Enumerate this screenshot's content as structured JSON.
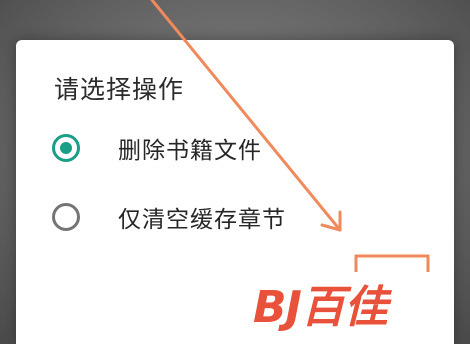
{
  "dialog": {
    "title": "请选择操作",
    "options": [
      {
        "label": "删除书籍文件",
        "selected": true
      },
      {
        "label": "仅清空缓存章节",
        "selected": false
      }
    ]
  },
  "colors": {
    "accent": "#1b9e87",
    "annotation": "#f08a5d",
    "watermark": "#e8513a"
  },
  "watermark": {
    "text": "BJ百佳"
  }
}
